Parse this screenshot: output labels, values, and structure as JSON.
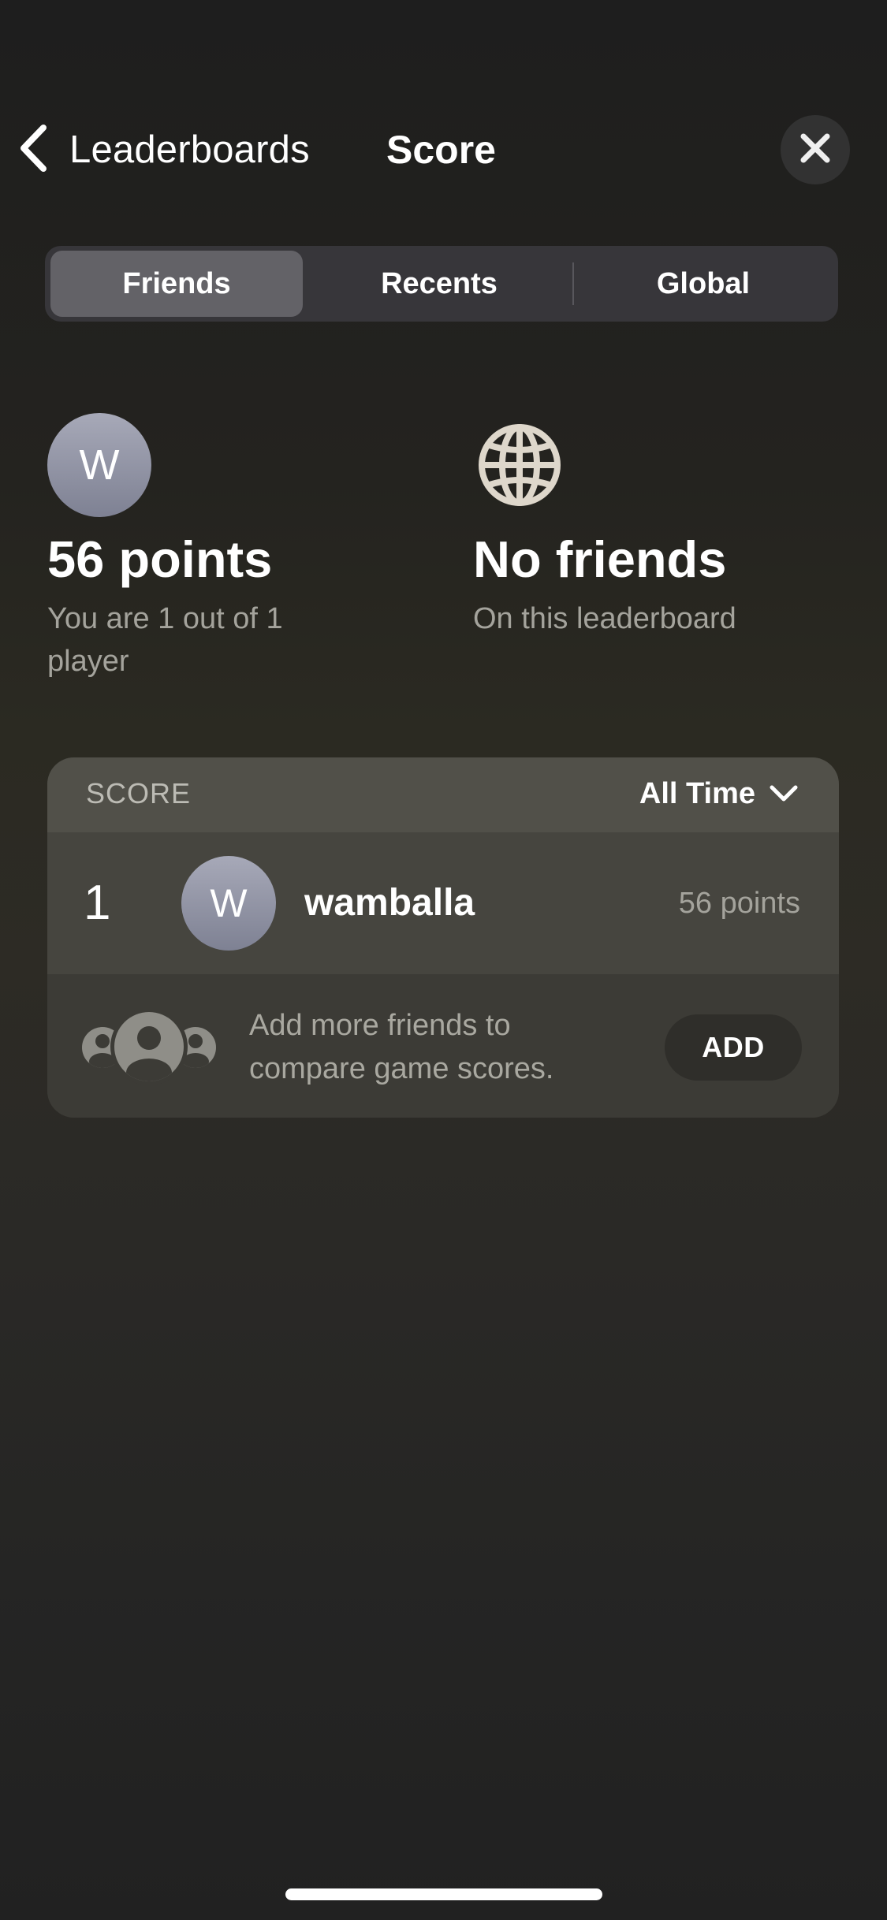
{
  "nav": {
    "back_label": "Leaderboards",
    "title": "Score",
    "back_icon": "chevron-left-icon",
    "close_icon": "close-icon"
  },
  "segments": {
    "items": [
      {
        "label": "Friends",
        "selected": true
      },
      {
        "label": "Recents",
        "selected": false
      },
      {
        "label": "Global",
        "selected": false
      }
    ]
  },
  "summary": {
    "avatar_initial": "W",
    "points": "56 points",
    "rank_text": "You are 1 out of 1 player",
    "globe_icon": "globe-icon",
    "friends_title": "No friends",
    "friends_subtitle": "On this leaderboard"
  },
  "score_card": {
    "header_label": "SCORE",
    "time_filter": "All Time",
    "filter_icon": "chevron-down-icon",
    "rows": [
      {
        "rank": "1",
        "avatar_initial": "W",
        "name": "wamballa",
        "points": "56 points"
      }
    ],
    "add_friends": {
      "icon": "friends-group-icon",
      "text": "Add more friends to compare game scores.",
      "button_label": "ADD"
    }
  },
  "colors": {
    "segment_selected": "#636267",
    "segment_bg": "#37363a",
    "secondary_text": "#a4a39c",
    "card_header": "#515049",
    "card_row": "#46453f",
    "card_bg": "#3c3b36",
    "globe": "#ded7cb"
  }
}
